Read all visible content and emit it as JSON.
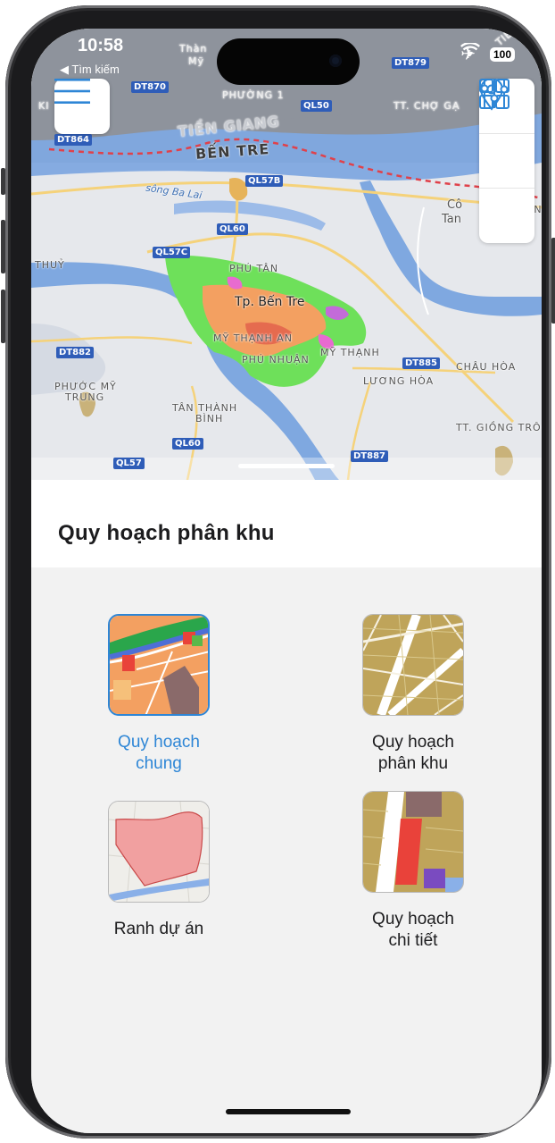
{
  "status_bar": {
    "time": "10:58",
    "back_label": "◀ Tìm kiếm",
    "battery": "100",
    "airplane_glyph": "✈",
    "wifi_icon": "wifi-icon"
  },
  "map": {
    "labels": {
      "ben_tre": "BẾN TRE",
      "tien_giang": "TIỀN GIANG",
      "tp_ben_tre": "Tp. Bến Tre",
      "phu_tan": "PHÚ TÂN",
      "my_thanh_an": "MỸ THẠNH AN",
      "phu_nhuan": "PHÚ NHUẬN",
      "my_thanh": "MỸ THẠNH",
      "chau_hoa": "CHÂU HÒA",
      "luong_hoa": "LƯƠNG HÒA",
      "phuoc_my_trung_1": "PHƯỚC MỸ",
      "phuoc_my_trung_2": "TRUNG",
      "tan_thanh_binh_1": "TÂN THÀNH",
      "tan_thanh_binh_2": "BÌNH",
      "giong_trom": "TT. GIỒNG TRÔ",
      "cho_gao": "TT. CHỢ GẠ",
      "phuong_1": "PHƯỜNG 1",
      "thuy": "THUỶ",
      "song_ba_lai": "sông Ba Lai",
      "thanh_my_1": "Thàn",
      "thanh_my_2": "Mỹ",
      "kien": "KI",
      "tan_1": "TÂN",
      "co_1": "Cô",
      "co_2": "Tan",
      "tien_corner": "TIỀ"
    },
    "shields": {
      "dt870": "DT870",
      "dt864": "DT864",
      "ql50": "QL50",
      "dt879": "DT879",
      "ql57b": "QL57B",
      "ql60a": "QL60",
      "ql57c": "QL57C",
      "dt882": "DT882",
      "dt885": "DT885",
      "ql60b": "QL60",
      "dt887": "DT887",
      "ql57": "QL57"
    },
    "controls": {
      "menu_icon": "menu-icon",
      "layers_icon": "grid-layers-icon",
      "location_icon": "location-pin-icon",
      "filter_icon": "sliders-icon"
    }
  },
  "sheet": {
    "title": "Quy hoạch phân khu",
    "options": [
      {
        "label_line1": "Quy hoạch",
        "label_line2": "chung",
        "selected": true
      },
      {
        "label_line1": "Quy hoạch",
        "label_line2": "phân khu",
        "selected": false
      },
      {
        "label_line1": "Ranh dự án",
        "label_line2": "",
        "selected": false
      },
      {
        "label_line1": "Quy hoạch",
        "label_line2": "chi tiết",
        "selected": false
      }
    ]
  },
  "colors": {
    "accent": "#2e86d6",
    "map_bg": "#e6e8ec",
    "river": "#7fa8e0",
    "planning_green": "#6ee05a",
    "planning_orange": "#f3a061"
  }
}
